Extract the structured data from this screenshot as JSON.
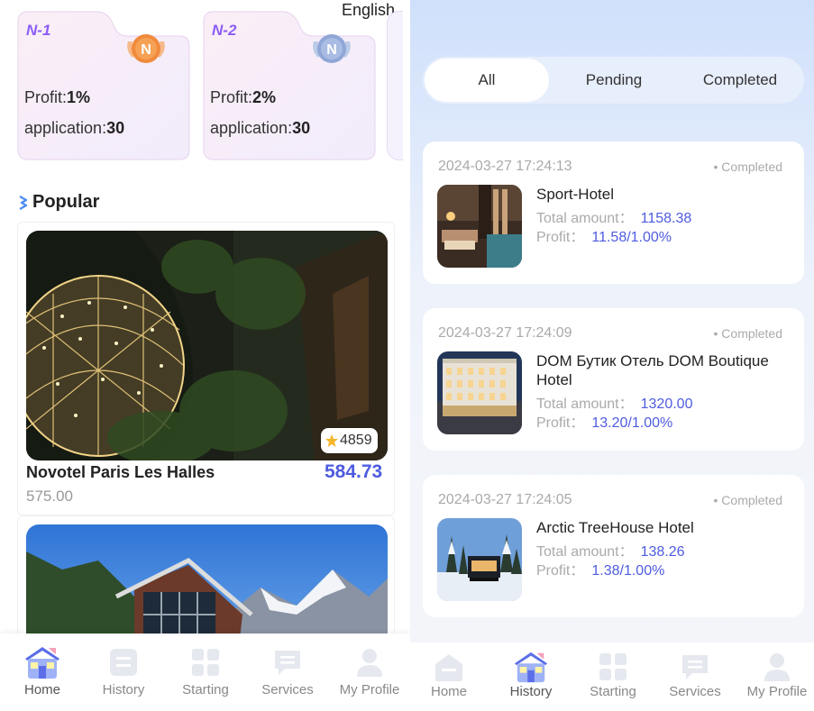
{
  "header": {
    "language": "English"
  },
  "levels": [
    {
      "name": "N-1",
      "badge_letter": "N",
      "profit_label": "Profit:",
      "profit_value": "1%",
      "application_label": "application:",
      "application_value": "30"
    },
    {
      "name": "N-2",
      "badge_letter": "N",
      "profit_label": "Profit:",
      "profit_value": "2%",
      "application_label": "application:",
      "application_value": "30"
    }
  ],
  "popular": {
    "title": "Popular",
    "hotels": [
      {
        "name": "Novotel Paris Les Halles",
        "price": "584.73",
        "old_price": "575.00",
        "rating": "4859"
      },
      {
        "name": "",
        "price": "",
        "old_price": "",
        "rating": ""
      }
    ]
  },
  "tabs_left": [
    {
      "label": "Home",
      "icon": "home-icon",
      "active": true
    },
    {
      "label": "History",
      "icon": "history-icon",
      "active": false
    },
    {
      "label": "Starting",
      "icon": "grid-icon",
      "active": false
    },
    {
      "label": "Services",
      "icon": "chat-icon",
      "active": false
    },
    {
      "label": "My Profile",
      "icon": "person-icon",
      "active": false
    }
  ],
  "history": {
    "filters": [
      "All",
      "Pending",
      "Completed"
    ],
    "active_filter": "All",
    "orders": [
      {
        "date": "2024-03-27 17:24:13",
        "status": "• Completed",
        "title": "Sport-Hotel",
        "amount_label": "Total amount：",
        "amount": "1158.38",
        "profit_label": "Profit：",
        "profit": "11.58/1.00%"
      },
      {
        "date": "2024-03-27 17:24:09",
        "status": "• Completed",
        "title": "DOM Бутик Отель DOM Boutique Hotel",
        "amount_label": "Total amount：",
        "amount": "1320.00",
        "profit_label": "Profit：",
        "profit": "13.20/1.00%"
      },
      {
        "date": "2024-03-27 17:24:05",
        "status": "• Completed",
        "title": "Arctic TreeHouse Hotel",
        "amount_label": "Total amount：",
        "amount": "138.26",
        "profit_label": "Profit：",
        "profit": "1.38/1.00%"
      }
    ]
  },
  "tabs_right": [
    {
      "label": "Home",
      "icon": "home-icon",
      "active": false
    },
    {
      "label": "History",
      "icon": "history-icon",
      "active": true
    },
    {
      "label": "Starting",
      "icon": "grid-icon",
      "active": false
    },
    {
      "label": "Services",
      "icon": "chat-icon",
      "active": false
    },
    {
      "label": "My Profile",
      "icon": "person-icon",
      "active": false
    }
  ],
  "colors": {
    "accent": "#4e5ce0",
    "level_name": "#8b5cf6",
    "muted": "#aaaaaa"
  }
}
